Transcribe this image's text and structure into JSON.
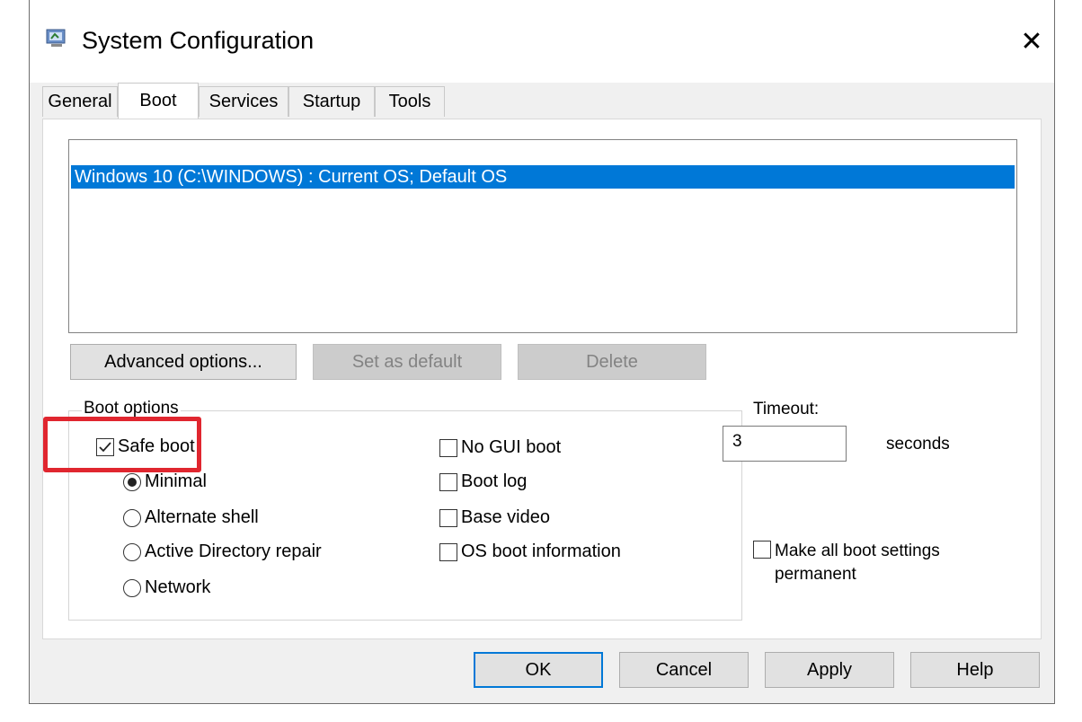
{
  "window": {
    "title": "System Configuration",
    "close_glyph": "✕",
    "icon": "msconfig-icon"
  },
  "tabs": [
    {
      "label": "General",
      "active": false
    },
    {
      "label": "Boot",
      "active": true
    },
    {
      "label": "Services",
      "active": false
    },
    {
      "label": "Startup",
      "active": false
    },
    {
      "label": "Tools",
      "active": false
    }
  ],
  "os_list": {
    "items": [
      "Windows 10 (C:\\WINDOWS) : Current OS; Default OS"
    ],
    "selected_index": 0
  },
  "os_buttons": {
    "advanced": "Advanced options...",
    "set_default": "Set as default",
    "delete": "Delete"
  },
  "boot_options": {
    "legend": "Boot options",
    "safe_boot": {
      "label": "Safe boot",
      "checked": true
    },
    "minimal": {
      "label": "Minimal",
      "selected": true
    },
    "alternate_shell": {
      "label": "Alternate shell",
      "selected": false
    },
    "ad_repair": {
      "label": "Active Directory repair",
      "selected": false
    },
    "network": {
      "label": "Network",
      "selected": false
    },
    "no_gui_boot": {
      "label": "No GUI boot",
      "checked": false
    },
    "boot_log": {
      "label": "Boot log",
      "checked": false
    },
    "base_video": {
      "label": "Base video",
      "checked": false
    },
    "os_boot_info": {
      "label": "OS boot information",
      "checked": false
    }
  },
  "timeout": {
    "label": "Timeout:",
    "value": "3",
    "unit": "seconds"
  },
  "permanent": {
    "label_line1": "Make all boot settings",
    "label_line2": "permanent",
    "checked": false
  },
  "footer": {
    "ok": "OK",
    "cancel": "Cancel",
    "apply": "Apply",
    "help": "Help"
  },
  "colors": {
    "selection": "#0078d7",
    "highlight_box": "#e0262f"
  }
}
